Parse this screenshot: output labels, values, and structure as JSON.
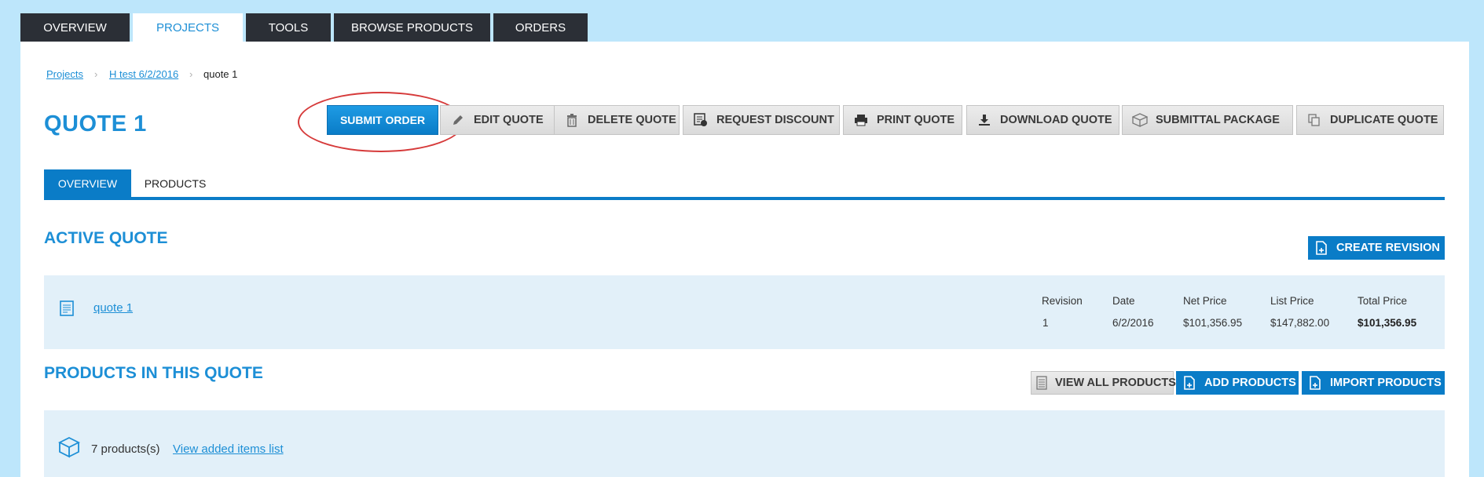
{
  "topnav": {
    "tabs": [
      {
        "label": "OVERVIEW"
      },
      {
        "label": "PROJECTS",
        "active": true
      },
      {
        "label": "TOOLS"
      },
      {
        "label": "BROWSE PRODUCTS"
      },
      {
        "label": "ORDERS"
      }
    ]
  },
  "breadcrumb": {
    "items": [
      "Projects",
      "H test 6/2/2016",
      "quote 1"
    ]
  },
  "page": {
    "title": "QUOTE 1"
  },
  "toolbar": {
    "submit_label": "SUBMIT ORDER",
    "edit_label": "EDIT QUOTE",
    "delete_label": "DELETE QUOTE",
    "discount_label": "REQUEST DISCOUNT",
    "print_label": "PRINT QUOTE",
    "download_label": "DOWNLOAD QUOTE",
    "submittal_label": "SUBMITTAL PACKAGE",
    "duplicate_label": "DUPLICATE QUOTE"
  },
  "subtabs": [
    {
      "label": "OVERVIEW",
      "active": true
    },
    {
      "label": "PRODUCTS"
    }
  ],
  "active_quote": {
    "title": "ACTIVE QUOTE",
    "create_revision_label": "CREATE REVISION",
    "quote_name": "quote 1",
    "columns": {
      "revision": "Revision",
      "date": "Date",
      "net_price": "Net Price",
      "list_price": "List Price",
      "total_price": "Total Price"
    },
    "values": {
      "revision": "1",
      "date": "6/2/2016",
      "net_price": "$101,356.95",
      "list_price": "$147,882.00",
      "total_price": "$101,356.95"
    }
  },
  "products": {
    "title": "PRODUCTS IN THIS QUOTE",
    "view_all_label": "VIEW ALL PRODUCTS",
    "add_label": "ADD PRODUCTS",
    "import_label": "IMPORT PRODUCTS",
    "count_text": "7 products(s)",
    "view_list_link": "View added items list"
  },
  "colors": {
    "accent": "#1d8fd6",
    "primary_button": "#0a7cc7",
    "nav_dark": "#2b2f36",
    "page_bg": "#bde6fb",
    "info_box_bg": "#e2f0f9",
    "highlight": "#d63a3a"
  },
  "icons": {
    "edit": "pencil-icon",
    "delete": "trash-icon",
    "discount": "discount-icon",
    "print": "printer-icon",
    "download": "download-icon",
    "submittal": "box-icon",
    "duplicate": "duplicate-icon",
    "quote": "document-icon",
    "create_revision": "new-document-icon",
    "view_all": "list-icon",
    "add_products": "add-document-icon",
    "import_products": "import-document-icon",
    "products_box": "package-icon"
  }
}
